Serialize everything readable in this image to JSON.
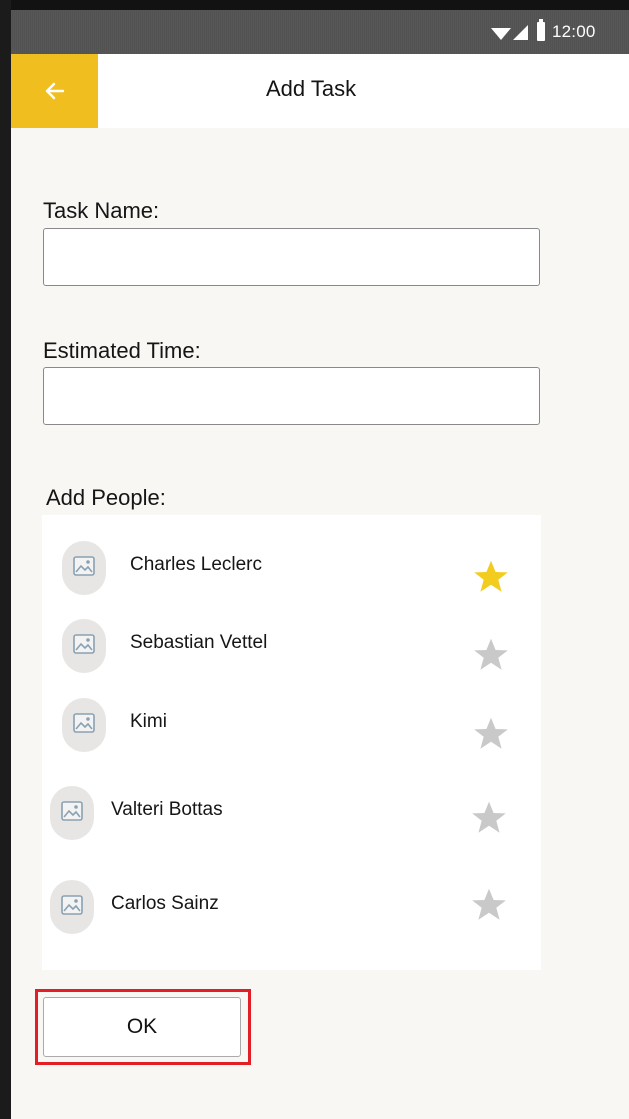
{
  "status_bar": {
    "time": "12:00",
    "icons": [
      "wifi-icon",
      "signal-icon",
      "battery-icon"
    ]
  },
  "app_bar": {
    "back_icon": "arrow-left-icon",
    "title": "Add Task",
    "accent_color": "#F0BF1F"
  },
  "form": {
    "task_name": {
      "label": "Task Name:",
      "value": "",
      "placeholder": ""
    },
    "estimated_time": {
      "label": "Estimated Time:",
      "value": "",
      "placeholder": ""
    },
    "people": {
      "label": "Add People:",
      "items": [
        {
          "name": "Charles Leclerc",
          "starred": true,
          "avatar_icon": "image-placeholder-icon"
        },
        {
          "name": "Sebastian Vettel",
          "starred": false,
          "avatar_icon": "image-placeholder-icon"
        },
        {
          "name": "Kimi",
          "starred": false,
          "avatar_icon": "image-placeholder-icon"
        },
        {
          "name": "Valteri Bottas",
          "starred": false,
          "avatar_icon": "image-placeholder-icon"
        },
        {
          "name": "Carlos Sainz",
          "starred": false,
          "avatar_icon": "image-placeholder-icon"
        }
      ]
    },
    "ok_button": {
      "label": "OK",
      "highlight_color": "#E21F26"
    }
  },
  "colors": {
    "star_active": "#F2CD1F",
    "star_inactive": "#C9C9C9",
    "background": "#F8F7F4"
  }
}
